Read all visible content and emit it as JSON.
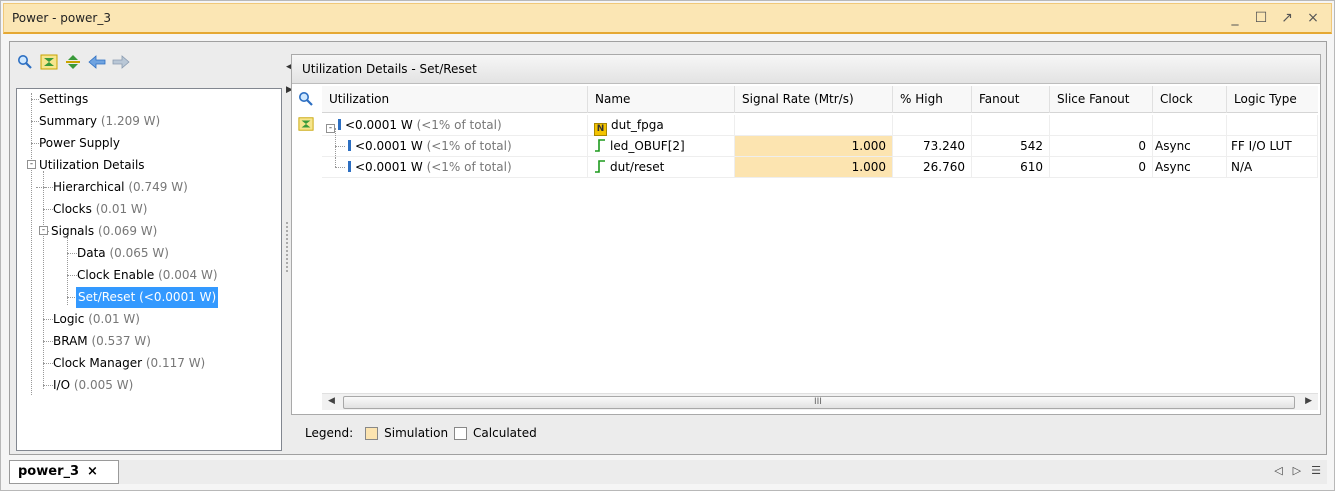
{
  "window": {
    "title": "Power - power_3",
    "controls": [
      "_",
      "☐",
      "↗",
      "×"
    ]
  },
  "left_toolbar": [
    "search-icon",
    "collapse-all-icon",
    "expand-all-icon",
    "back-icon",
    "forward-icon"
  ],
  "tree": {
    "settings": {
      "label": "Settings"
    },
    "summary": {
      "label": "Summary",
      "value": "(1.209 W)"
    },
    "power_supply": {
      "label": "Power Supply"
    },
    "utilization_details": {
      "label": "Utilization Details",
      "expander": "-"
    },
    "hierarchical": {
      "label": "Hierarchical",
      "value": "(0.749 W)"
    },
    "clocks": {
      "label": "Clocks",
      "value": "(0.01 W)"
    },
    "signals": {
      "label": "Signals",
      "value": "(0.069 W)",
      "expander": "-"
    },
    "data": {
      "label": "Data",
      "value": "(0.065 W)"
    },
    "clock_enable": {
      "label": "Clock Enable",
      "value": "(0.004 W)"
    },
    "set_reset": {
      "label": "Set/Reset",
      "value": "(<0.0001 W)"
    },
    "logic": {
      "label": "Logic",
      "value": "(0.01 W)"
    },
    "bram": {
      "label": "BRAM",
      "value": "(0.537 W)"
    },
    "clock_manager": {
      "label": "Clock Manager",
      "value": "(0.117 W)"
    },
    "io": {
      "label": "I/O",
      "value": "(0.005 W)"
    }
  },
  "panel": {
    "title": "Utilization Details - Set/Reset",
    "columns": [
      "Utilization",
      "Name",
      "Signal Rate (Mtr/s)",
      "% High",
      "Fanout",
      "Slice Fanout",
      "Clock",
      "Logic Type"
    ],
    "rows": [
      {
        "power": "<0.0001 W",
        "pct": "(<1% of total)",
        "name": "dut_fpga",
        "signal_rate": "",
        "high": "",
        "fanout": "",
        "slice_fanout": "",
        "clock": "",
        "logic_type": ""
      },
      {
        "power": "<0.0001 W",
        "pct": "(<1% of total)",
        "name": "led_OBUF[2]",
        "signal_rate": "1.000",
        "high": "73.240",
        "fanout": "542",
        "slice_fanout": "0",
        "clock": "Async",
        "logic_type": "FF I/O LUT"
      },
      {
        "power": "<0.0001 W",
        "pct": "(<1% of total)",
        "name": "dut/reset",
        "signal_rate": "1.000",
        "high": "26.760",
        "fanout": "610",
        "slice_fanout": "0",
        "clock": "Async",
        "logic_type": "N/A"
      }
    ],
    "scroll_grip": "III"
  },
  "legend": {
    "label": "Legend:",
    "simulation": "Simulation",
    "calculated": "Calculated"
  },
  "colors": {
    "simulation": "#fce4b0",
    "calculated": "#ffffff",
    "selection": "#3399ff",
    "title_bar": "#fbe6b4"
  },
  "tabs": [
    {
      "label": "power_3",
      "close": "×"
    }
  ],
  "tab_nav": [
    "◁",
    "▷",
    "☰"
  ]
}
